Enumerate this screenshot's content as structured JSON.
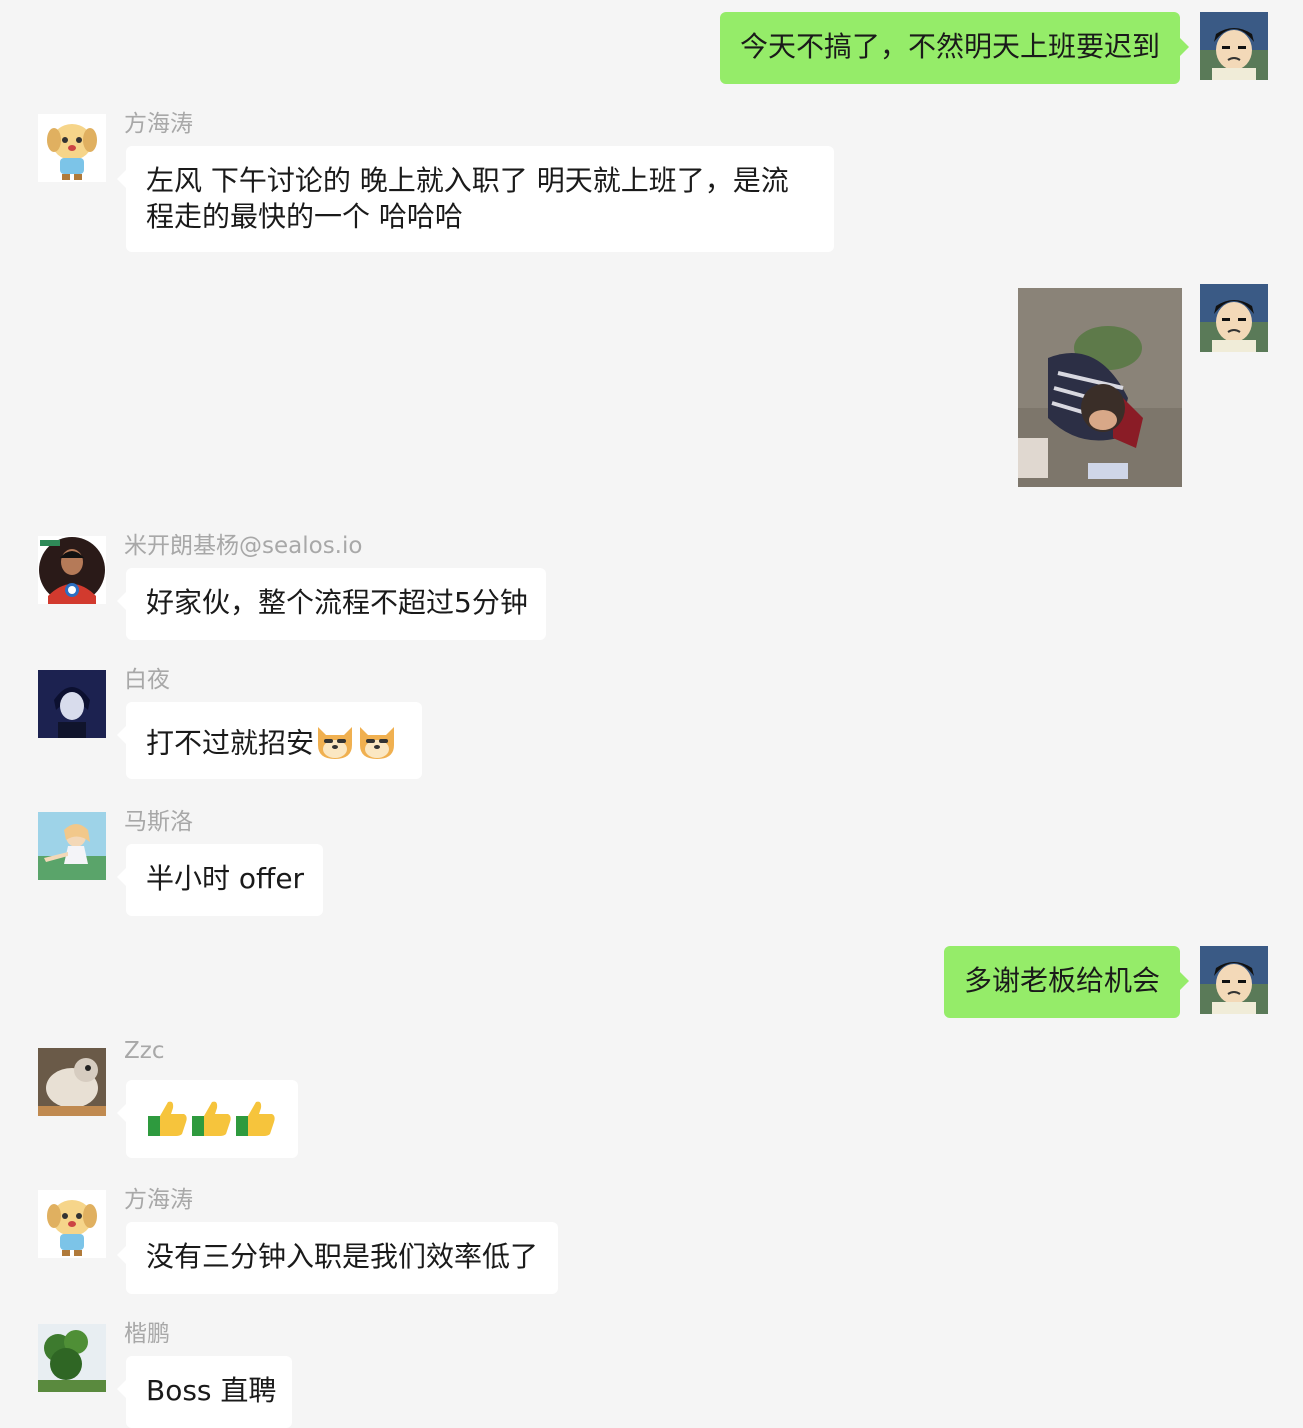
{
  "messages": [
    {
      "side": "out",
      "text": "今天不搞了，不然明天上班要迟到"
    },
    {
      "side": "in",
      "sender": "方海涛",
      "text": "左风 下午讨论的 晚上就入职了 明天就上班了，是流程走的最快的一个 哈哈哈"
    },
    {
      "side": "out",
      "type": "image",
      "image_desc": "photo of child crawling"
    },
    {
      "side": "in",
      "sender": "米开朗基杨@sealos.io",
      "text": "好家伙，整个流程不超过5分钟"
    },
    {
      "side": "in",
      "sender": "白夜",
      "text": "打不过就招安",
      "emoji": [
        "doge-icon",
        "doge-icon"
      ]
    },
    {
      "side": "in",
      "sender": "马斯洛",
      "text": "半小时 offer"
    },
    {
      "side": "out",
      "text": "多谢老板给机会"
    },
    {
      "side": "in",
      "sender": "Zzc",
      "text": "",
      "emoji": [
        "thumbs-up-icon",
        "thumbs-up-icon",
        "thumbs-up-icon"
      ]
    },
    {
      "side": "in",
      "sender": "方海涛",
      "text": "没有三分钟入职是我们效率低了"
    },
    {
      "side": "in",
      "sender": "楷鹏",
      "text": "Boss 直聘"
    }
  ],
  "colors": {
    "out_bubble": "#95ec69",
    "in_bubble": "#ffffff",
    "background": "#f5f5f5",
    "sender_name": "#a8a8a8"
  }
}
